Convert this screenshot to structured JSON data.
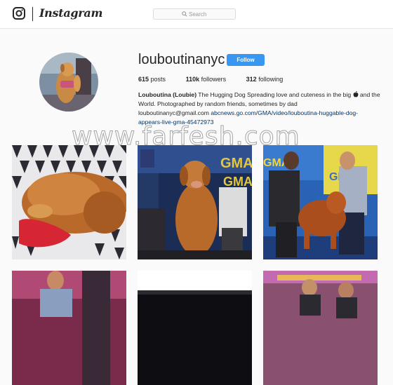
{
  "header": {
    "brand": "Instagram",
    "search_placeholder": "Search"
  },
  "profile": {
    "username": "louboutinanyc",
    "follow_label": "Follow",
    "stats": {
      "posts_count": "615",
      "posts_label": "posts",
      "followers_count": "110k",
      "followers_label": "followers",
      "following_count": "312",
      "following_label": "following"
    },
    "bio": {
      "name": "Louboutina (Loubie)",
      "text": " The Hugging Dog Spreading love and cuteness in the big ",
      "text2": " and the World. Photographed by random friends, sometimes by dad",
      "email": "louboutinanyc@gmail.com",
      "link": "abcnews.go.com/GMA/video/louboutina-huggable-dog-appears-live-gma-45472973"
    }
  },
  "watermark": "www.farfesh.com",
  "colors": {
    "follow_blue": "#3897f0",
    "link_blue": "#003569",
    "border": "#dbdbdb",
    "background": "#fafafa"
  },
  "icons": {
    "logo": "instagram-camera-icon",
    "search": "magnifier-icon",
    "apple": "apple-icon"
  }
}
